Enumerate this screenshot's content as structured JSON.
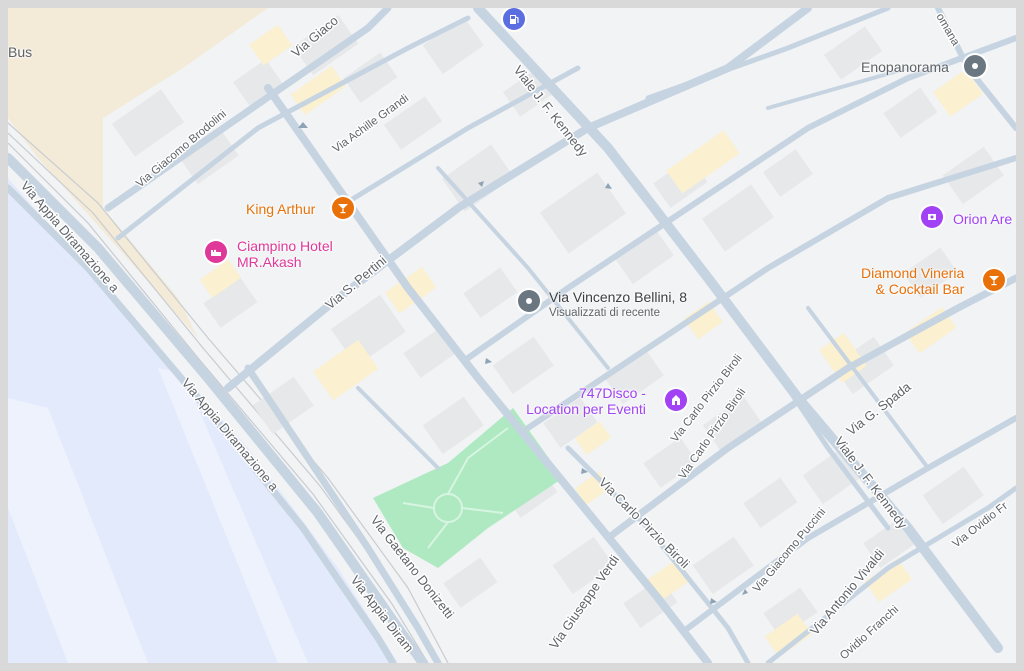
{
  "colors": {
    "water": "#e3eafc",
    "sand": "#f3ead8",
    "park": "#aee9c2",
    "road": "#c6d3e1",
    "building": "#e6e8ea",
    "building_yellow": "#fbf0cf",
    "bar_orange": "#e8710a",
    "hotel_pink": "#e0389a",
    "venue_purple": "#a142f4",
    "pin_gray": "#6b7780",
    "fuel_blue": "#5b6ee1"
  },
  "roads": {
    "via_appia_1": "Via Appia Diramazione a",
    "via_appia_2": "Via Appia Diramazione a",
    "via_appia_3": "Via Appia Diram",
    "via_giacomo_brodolini": "Via Giacomo Brodolini",
    "via_achille_grandi": "Via Achille Grandi",
    "via_giaco": "Via Giaco",
    "viale_kennedy_1": "Viale J. F. Kennedy",
    "viale_kennedy_2": "Viale J. F. Kennedy",
    "via_s_pertini": "Via S. Pertini",
    "via_g_spada": "Via G. Spada",
    "via_carlo_pirzio_biroli_1": "Via Carlo Pirzio Biroli",
    "via_carlo_pirzio_biroli_2": "Via Carlo Pirzio Biroli",
    "via_carlo_pirzio_biroli_3": "Via Carlo Pirzio Biroli",
    "via_giuseppe_verdi": "Via Giuseppe Verdi",
    "via_gaetano_donizetti": "Via Gaetano Donizetti",
    "via_giacomo_puccini": "Via Giacomo Puccini",
    "via_antonio_vivaldi": "Via Antonio Vivaldi",
    "ovidio_franchi": "Ovidio Franchi",
    "via_ovidio_fr": "Via Ovidio Fr",
    "romana": "omana"
  },
  "places": {
    "bus": {
      "label": "Bus"
    },
    "king_arthur": {
      "label": "King Arthur",
      "icon": "cocktail-icon"
    },
    "ciampino_hotel": {
      "label_line1": "Ciampino Hotel",
      "label_line2": "MR.Akash",
      "icon": "hotel-icon"
    },
    "via_bellini": {
      "label": "Via Vincenzo Bellini, 8",
      "sub": "Visualizzati di recente",
      "icon": "location-pin-icon"
    },
    "disco_747": {
      "label_line1": "747Disco -",
      "label_line2": "Location per Eventi",
      "icon": "venue-icon"
    },
    "enopanorama": {
      "label": "Enopanorama",
      "icon": "location-pin-icon"
    },
    "orion": {
      "label": "Orion Are",
      "icon": "venue-icon"
    },
    "diamond_vineria": {
      "label_line1": "Diamond Vineria",
      "label_line2": "& Cocktail Bar",
      "icon": "cocktail-icon"
    },
    "fuel": {
      "icon": "fuel-icon"
    }
  }
}
